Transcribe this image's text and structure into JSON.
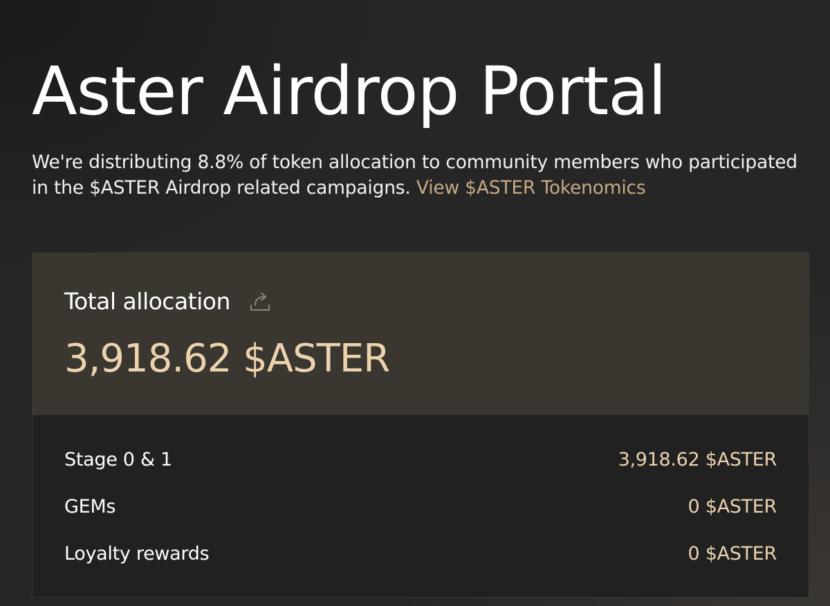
{
  "header": {
    "title": "Aster Airdrop Portal",
    "description": "We're distributing 8.8% of token allocation to community members who participated in the $ASTER Airdrop related campaigns.",
    "tokenomics_link": "View $ASTER Tokenomics"
  },
  "allocation": {
    "total_label": "Total allocation",
    "total_value": "3,918.62 $ASTER",
    "share_icon": "share-icon",
    "rows": [
      {
        "label": "Stage 0 & 1",
        "value": "3,918.62 $ASTER"
      },
      {
        "label": "GEMs",
        "value": "0 $ASTER"
      },
      {
        "label": "Loyalty rewards",
        "value": "0 $ASTER"
      }
    ]
  },
  "colors": {
    "background": "#262626",
    "accent_gold": "#ecd3ae",
    "link": "#c8aa84",
    "card_header": "#3a3630",
    "card_body": "#212121"
  }
}
